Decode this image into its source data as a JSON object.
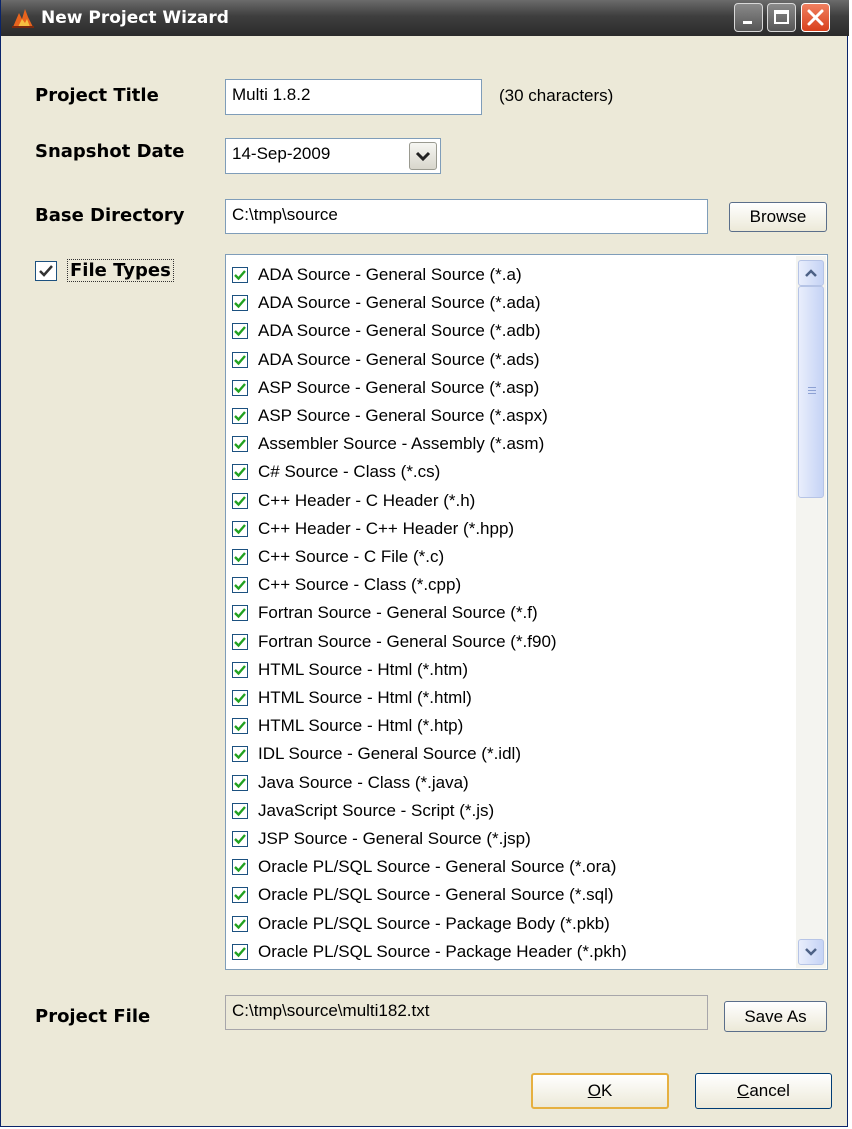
{
  "window": {
    "title": "New Project Wizard"
  },
  "form": {
    "project_title_label": "Project Title",
    "project_title_value": "Multi 1.8.2",
    "project_title_hint": "(30 characters)",
    "snapshot_date_label": "Snapshot Date",
    "snapshot_date_value": "14-Sep-2009",
    "base_directory_label": "Base Directory",
    "base_directory_value": "C:\\tmp\\source",
    "browse_label": "Browse",
    "file_types_label": "File Types",
    "project_file_label": "Project File",
    "project_file_value": "C:\\tmp\\source\\multi182.txt",
    "save_as_label": "Save As"
  },
  "file_types": [
    "ADA Source - General Source (*.a)",
    "ADA Source - General Source (*.ada)",
    "ADA Source - General Source (*.adb)",
    "ADA Source - General Source (*.ads)",
    "ASP Source - General Source (*.asp)",
    "ASP Source - General Source (*.aspx)",
    "Assembler Source - Assembly (*.asm)",
    "C# Source - Class (*.cs)",
    "C++ Header - C Header (*.h)",
    "C++ Header - C++ Header (*.hpp)",
    "C++ Source - C File (*.c)",
    "C++ Source - Class (*.cpp)",
    "Fortran Source - General Source (*.f)",
    "Fortran Source - General Source (*.f90)",
    "HTML Source - Html (*.htm)",
    "HTML Source - Html (*.html)",
    "HTML Source - Html (*.htp)",
    "IDL Source - General Source (*.idl)",
    "Java Source - Class (*.java)",
    "JavaScript Source - Script (*.js)",
    "JSP Source - General Source (*.jsp)",
    "Oracle PL/SQL Source - General Source (*.ora)",
    "Oracle PL/SQL Source - General Source (*.sql)",
    "Oracle PL/SQL Source - Package Body (*.pkb)",
    "Oracle PL/SQL Source - Package Header (*.pkh)"
  ],
  "buttons": {
    "ok_prefix": "",
    "ok_mnemonic": "O",
    "ok_rest": "K",
    "cancel_mnemonic": "C",
    "cancel_rest": "ancel"
  },
  "icons": [
    "app-flame-icon",
    "minimize-icon",
    "maximize-icon",
    "close-icon",
    "dropdown-arrow-icon",
    "checkmark-icon",
    "scroll-up-icon",
    "scroll-down-icon"
  ],
  "colors": {
    "titlebar": "#3e3e3e",
    "dialog_bg": "#ece9d8",
    "close_button": "#e0502c",
    "field_border": "#7f9db9",
    "checkbox_border": "#1c5180",
    "check_color": "#21a121",
    "ok_focus_border": "#e6b040"
  }
}
